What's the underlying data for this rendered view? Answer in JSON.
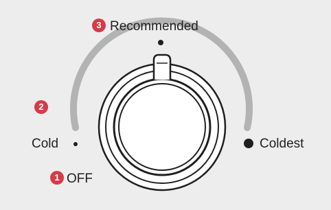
{
  "dial": {
    "settings": [
      {
        "step": "1",
        "label": "OFF"
      },
      {
        "step": "2",
        "label": "Cold"
      },
      {
        "step": "3",
        "label": "Recommended"
      },
      {
        "step": "",
        "label": "Coldest"
      }
    ]
  },
  "colors": {
    "background": "#ededed",
    "badge": "#d63b48",
    "track": "#b3b3b3",
    "ink": "#1f1f1f"
  },
  "icons": [
    "step-badge",
    "position-dot",
    "temperature-knob",
    "range-arc"
  ]
}
